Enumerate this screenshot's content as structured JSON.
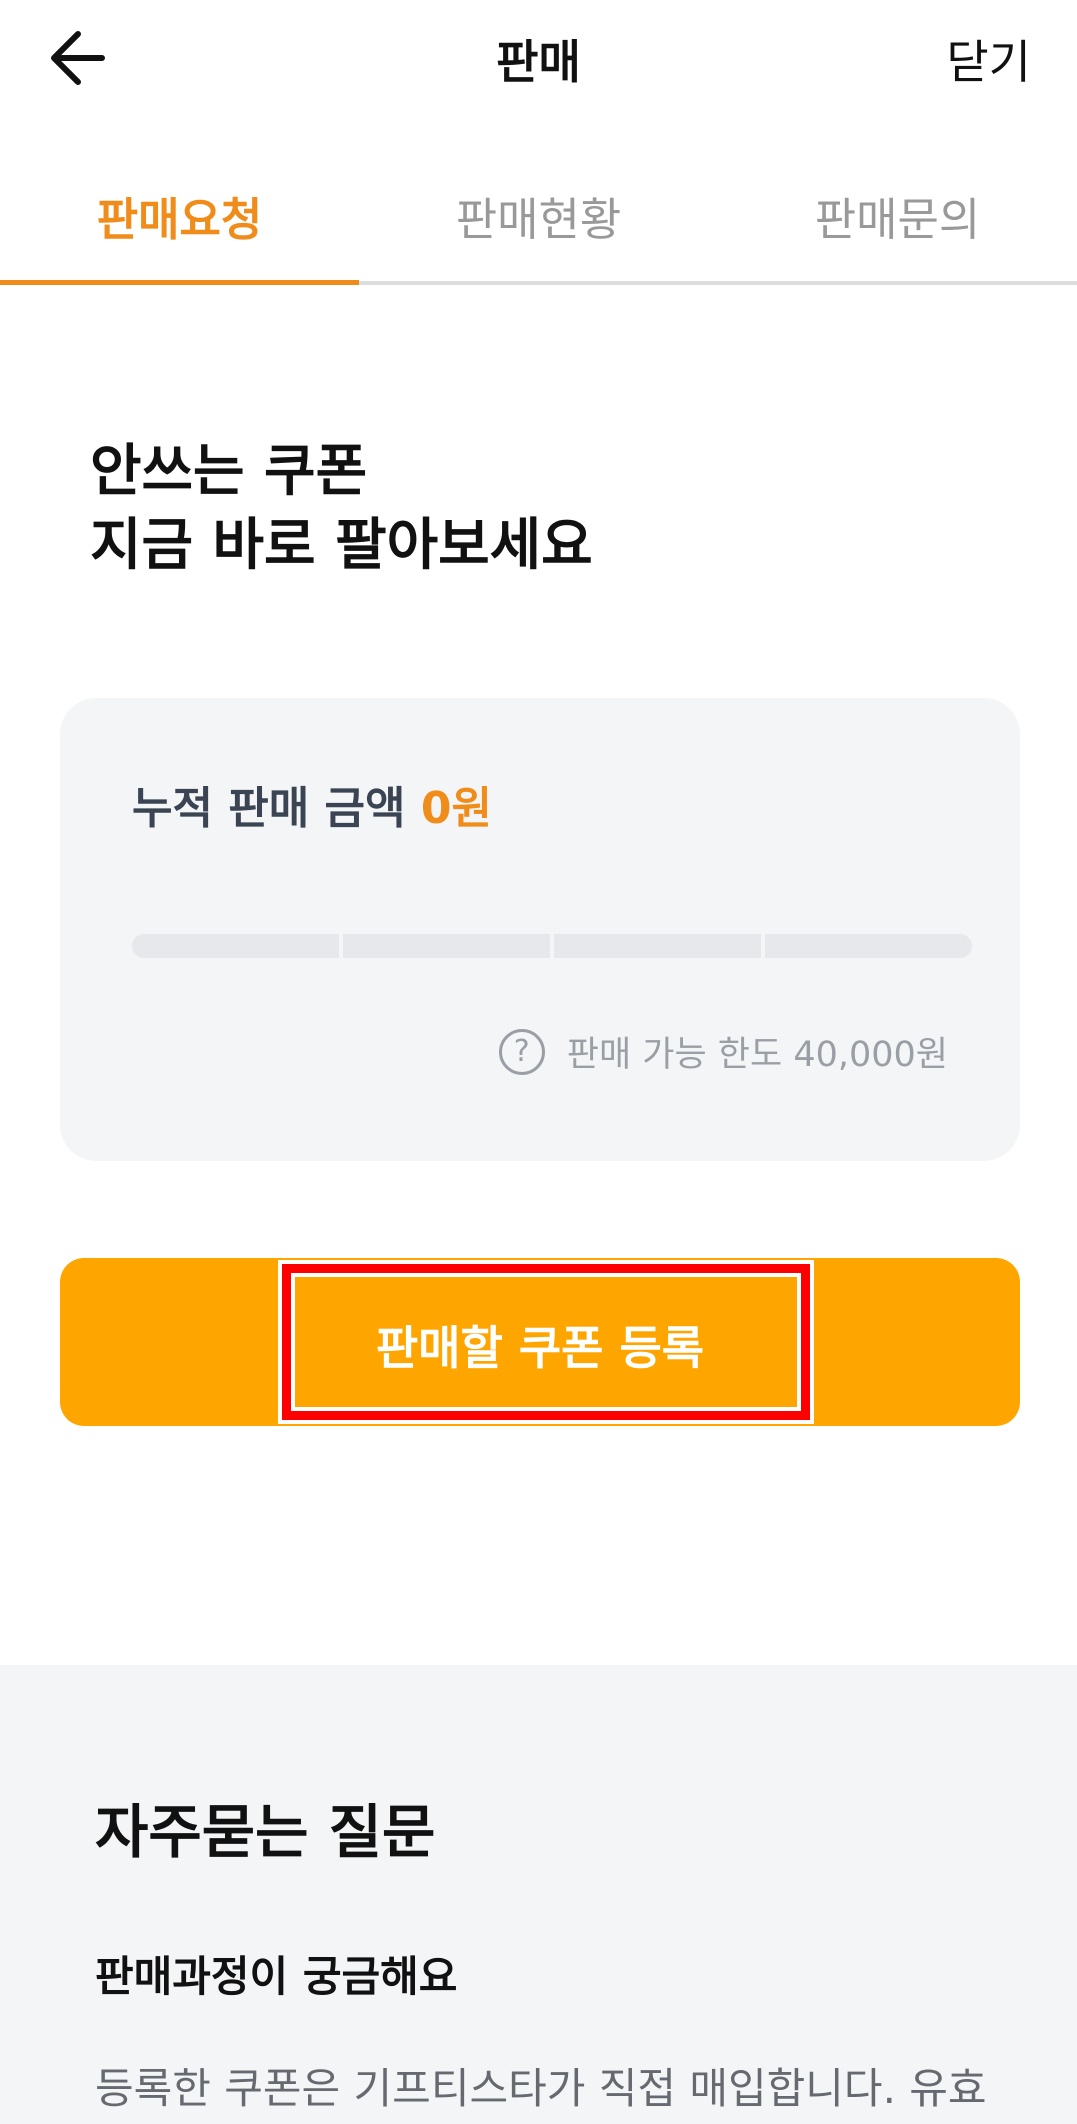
{
  "header": {
    "title": "판매",
    "close_label": "닫기",
    "back_icon": "arrow-left-icon"
  },
  "tabs": [
    {
      "label": "판매요청",
      "active": true
    },
    {
      "label": "판매현황",
      "active": false
    },
    {
      "label": "판매문의",
      "active": false
    }
  ],
  "hero": {
    "line1": "안쓰는 쿠폰",
    "line2": "지금 바로 팔아보세요"
  },
  "sales_card": {
    "label": "누적 판매 금액",
    "amount": "0원",
    "progress_fraction": 0,
    "limit_text": "판매 가능 한도 40,000원",
    "help_icon": "question-circle-icon",
    "help_glyph": "?"
  },
  "cta": {
    "label": "판매할 쿠폰 등록"
  },
  "faq": {
    "title": "자주묻는 질문",
    "question": "판매과정이 궁금해요",
    "answer": "등록한 쿠폰은 기프티스타가 직접 매입합니다. 유효"
  },
  "colors": {
    "accent": "#f08c1a",
    "cta_background": "#ffa500",
    "highlight_border": "#ff0000"
  }
}
